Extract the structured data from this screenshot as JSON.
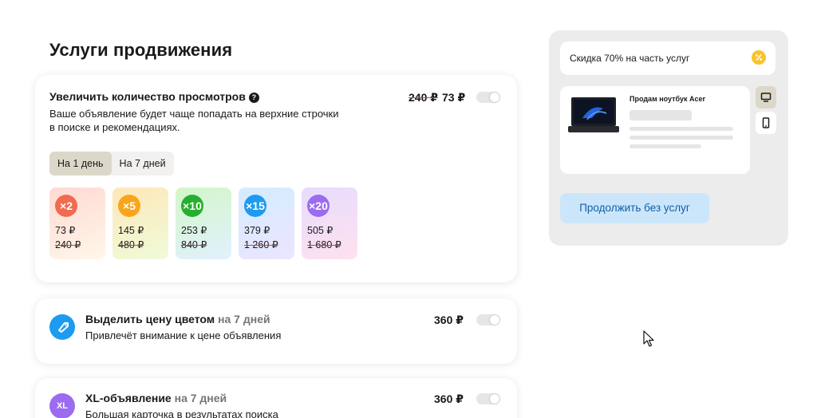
{
  "page": {
    "title": "Услуги продвижения"
  },
  "views_service": {
    "title": "Увеличить количество просмотров",
    "help": "?",
    "description_line1": "Ваше объявление будет чаще попадать на верхние строчки",
    "description_line2": "в поиске и рекомендациях.",
    "old_price": "240 ₽",
    "price": "73 ₽",
    "enabled": false,
    "duration_tabs": [
      {
        "label": "На 1 день",
        "active": true
      },
      {
        "label": "На 7 дней",
        "active": false
      }
    ],
    "options": [
      {
        "multiplier": "×2",
        "price": "73 ₽",
        "old_price": "240 ₽",
        "color": "#f26a4f",
        "bg_from": "#ffd9d3",
        "bg_to": "#fff7e9"
      },
      {
        "multiplier": "×5",
        "price": "145 ₽",
        "old_price": "480 ₽",
        "color": "#f9a51c",
        "bg_from": "#ffe7b9",
        "bg_to": "#eefbd9"
      },
      {
        "multiplier": "×10",
        "price": "253 ₽",
        "old_price": "840 ₽",
        "color": "#27ae2f",
        "bg_from": "#d3f6c8",
        "bg_to": "#e1f1ff"
      },
      {
        "multiplier": "×15",
        "price": "379 ₽",
        "old_price": "1 260 ₽",
        "color": "#1d9bf0",
        "bg_from": "#d4ecff",
        "bg_to": "#ebe5ff"
      },
      {
        "multiplier": "×20",
        "price": "505 ₽",
        "old_price": "1 680 ₽",
        "color": "#9b6cf0",
        "bg_from": "#e6dcff",
        "bg_to": "#ffe1ee"
      }
    ]
  },
  "color_service": {
    "title": "Выделить цену цветом",
    "duration": "на 7 дней",
    "description": "Привлечёт внимание к цене объявления",
    "price": "360 ₽",
    "enabled": false,
    "icon": "tag-icon",
    "icon_color": "#1d9bf0"
  },
  "xl_service": {
    "title": "XL-объявление",
    "duration": "на 7 дней",
    "description": "Большая карточка в результатах поиска",
    "price": "360 ₽",
    "enabled": false,
    "icon_text": "XL",
    "icon_color": "#9b6cf0"
  },
  "sidebar": {
    "discount_text": "Скидка 70% на часть услуг",
    "discount_icon": "percent-icon",
    "preview_title": "Продам ноутбук Acer",
    "continue_label": "Продолжить без услуг"
  }
}
